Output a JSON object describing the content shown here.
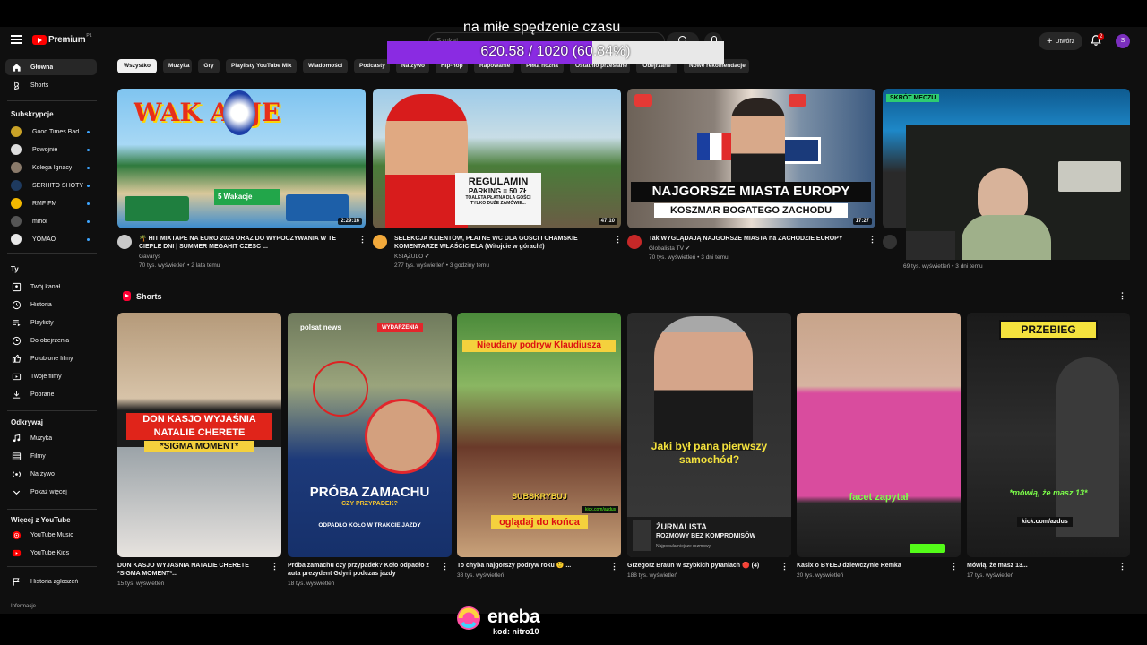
{
  "overlay": {
    "caption": "na miłe spędzenie czasu",
    "progress_text": "620.58 / 1020 (60.84%)",
    "progress_fraction": 0.6084
  },
  "masthead": {
    "logo_text": "Premium",
    "logo_region": "PL",
    "search_placeholder": "Szukaj",
    "create_label": "Utwórz",
    "notifications_count": "2",
    "avatar_letter": "S"
  },
  "sidebar": {
    "main": [
      {
        "label": "Główna",
        "icon": "home-icon"
      },
      {
        "label": "Shorts",
        "icon": "shorts-icon"
      }
    ],
    "subs_header": "Subskrypcje",
    "subscriptions": [
      {
        "label": "Good Times Bad ...",
        "color": "#c9a227"
      },
      {
        "label": "Powojnie",
        "color": "#dddddd"
      },
      {
        "label": "Kolega Ignacy",
        "color": "#8a7a6a"
      },
      {
        "label": "SERHITO SHOTY",
        "color": "#1e3a5f"
      },
      {
        "label": "RMF FM",
        "color": "#f2b800"
      },
      {
        "label": "mihol",
        "color": "#555555"
      },
      {
        "label": "YOMAO",
        "color": "#e8e8e8"
      }
    ],
    "you_header": "Ty",
    "you": [
      {
        "label": "Twój kanał",
        "icon": "channel-icon"
      },
      {
        "label": "Historia",
        "icon": "history-icon"
      },
      {
        "label": "Playlisty",
        "icon": "playlists-icon"
      },
      {
        "label": "Do obejrzenia",
        "icon": "watch-later-icon"
      },
      {
        "label": "Polubione filmy",
        "icon": "liked-icon"
      },
      {
        "label": "Twoje filmy",
        "icon": "your-videos-icon"
      },
      {
        "label": "Pobrane",
        "icon": "download-icon"
      }
    ],
    "explore_header": "Odkrywaj",
    "explore": [
      {
        "label": "Muzyka",
        "icon": "music-icon"
      },
      {
        "label": "Filmy",
        "icon": "movies-icon"
      },
      {
        "label": "Na żywo",
        "icon": "live-icon"
      },
      {
        "label": "Pokaż więcej",
        "icon": "chevron-down-icon"
      }
    ],
    "more_header": "Więcej z YouTube",
    "more": [
      {
        "label": "YouTube Music",
        "icon": "yt-music-icon"
      },
      {
        "label": "YouTube Kids",
        "icon": "yt-kids-icon"
      }
    ],
    "report": {
      "label": "Historia zgłoszeń",
      "icon": "flag-icon"
    },
    "footer": "Informacje"
  },
  "chips": [
    "Wszystko",
    "Muzyka",
    "Gry",
    "Playlisty YouTube Mix",
    "Wiadomości",
    "Podcasty",
    "Na żywo",
    "Hip-hop",
    "Rapowanie",
    "Piłka nożna",
    "Ostatnio przesłane",
    "Obejrzane",
    "Nowe rekomendacje"
  ],
  "videos": [
    {
      "title": "🌴 HIT MIXTAPE NA EURO 2024 ORAZ DO WYPOCZYWANIA W TE CIEPLE DNI | SUMMER MEGAHIT CZESC ...",
      "channel": "Gavarys",
      "meta": "70 tys. wyświetleń • 2 lata temu",
      "duration": "2:29:16",
      "thumb_text": "WAK   ACJE",
      "badge_text": "5  Wakacje"
    },
    {
      "title": "SELEKCJA KLIENTÓW, PŁATNE WC DLA GOŚCI I CHAMSKIE KOMENTARZE WŁAŚCICIELA (Witojcie w górach!)",
      "channel": "KSIĄŻULO ✔",
      "meta": "277 tys. wyświetleń • 3 godziny temu",
      "duration": "47:10",
      "thumb_text": "REGULAMIN",
      "thumb_sub": "PARKING = 50 ZŁ",
      "thumb_sub2": "TOALETA PŁATNA DLA GOŚCI",
      "thumb_sub3": "TYLKO DUŻE ZAMÓWIE..."
    },
    {
      "title": "Tak WYGLĄDAJĄ NAJGORSZE MIASTA na ZACHODZIE EUROPY",
      "channel": "Globalista TV ✔",
      "meta": "70 tys. wyświetleń • 3 dni temu",
      "duration": "17:27",
      "thumb_text": "NAJGORSZE MIASTA EUROPY",
      "thumb_sub": "KOSZMAR BOGATEGO ZACHODU"
    },
    {
      "title": "",
      "channel": "",
      "meta": "69 tys. wyświetleń • 3 dni temu",
      "thumb_text": "SKRÓT MECZU"
    }
  ],
  "shorts_header": "Shorts",
  "shorts": [
    {
      "title": "DON KASJO WYJAŚNIA NATALIE CHERETE *SIGMA MOMENT*...",
      "meta": "15 tys. wyświetleń",
      "ovl1": "DON KASJO WYJAŚNIA",
      "ovl2": "NATALIE CHERETE",
      "ovl3": "*SIGMA MOMENT*"
    },
    {
      "title": "Próba zamachu czy przypadek? Koło odpadło z auta prezydent Gdyni podczas jazdy",
      "meta": "18 tys. wyświetleń",
      "ovl1": "PRÓBA ZAMACHU",
      "ovl2": "CZY PRZYPADEK?",
      "ovl3": "ODPADŁO KOŁO W TRAKCIE JAZDY",
      "tag": "WYDARZENIA",
      "brand": "polsat news"
    },
    {
      "title": "To chyba najgorszy podryw roku 🙂 ...",
      "meta": "38 tys. wyświetleń",
      "ovl1": "Nieudany podryw Klaudiusza",
      "ovl2": "SUBSKRYBUJ",
      "ovl3": "oglądaj do końca",
      "site": "kick.com/azdus"
    },
    {
      "title": "Grzegorz Braun w szybkich pytaniach 🔴 (4)",
      "meta": "188 tys. wyświetleń",
      "ovl1": "Jaki był pana pierwszy samochód?",
      "ovl2": "ŻURNALISTA",
      "ovl3": "ROZMOWY BEZ KOMPROMISÓW",
      "ovl4": "Najpopularniejsze rozmowy"
    },
    {
      "title": "Kasix o BYŁEJ dziewczynie Remka",
      "meta": "20 tys. wyświetleń",
      "ovl1": "facet zapytał"
    },
    {
      "title": "Mówią, że masz 13...",
      "meta": "17 tys. wyświetleń",
      "ovl1": "PRZEBIEG",
      "ovl2": "*mówią, że masz 13*",
      "site": "kick.com/azdus"
    }
  ],
  "sponsor": {
    "name": "eneba",
    "code": "kod: nitro10"
  }
}
